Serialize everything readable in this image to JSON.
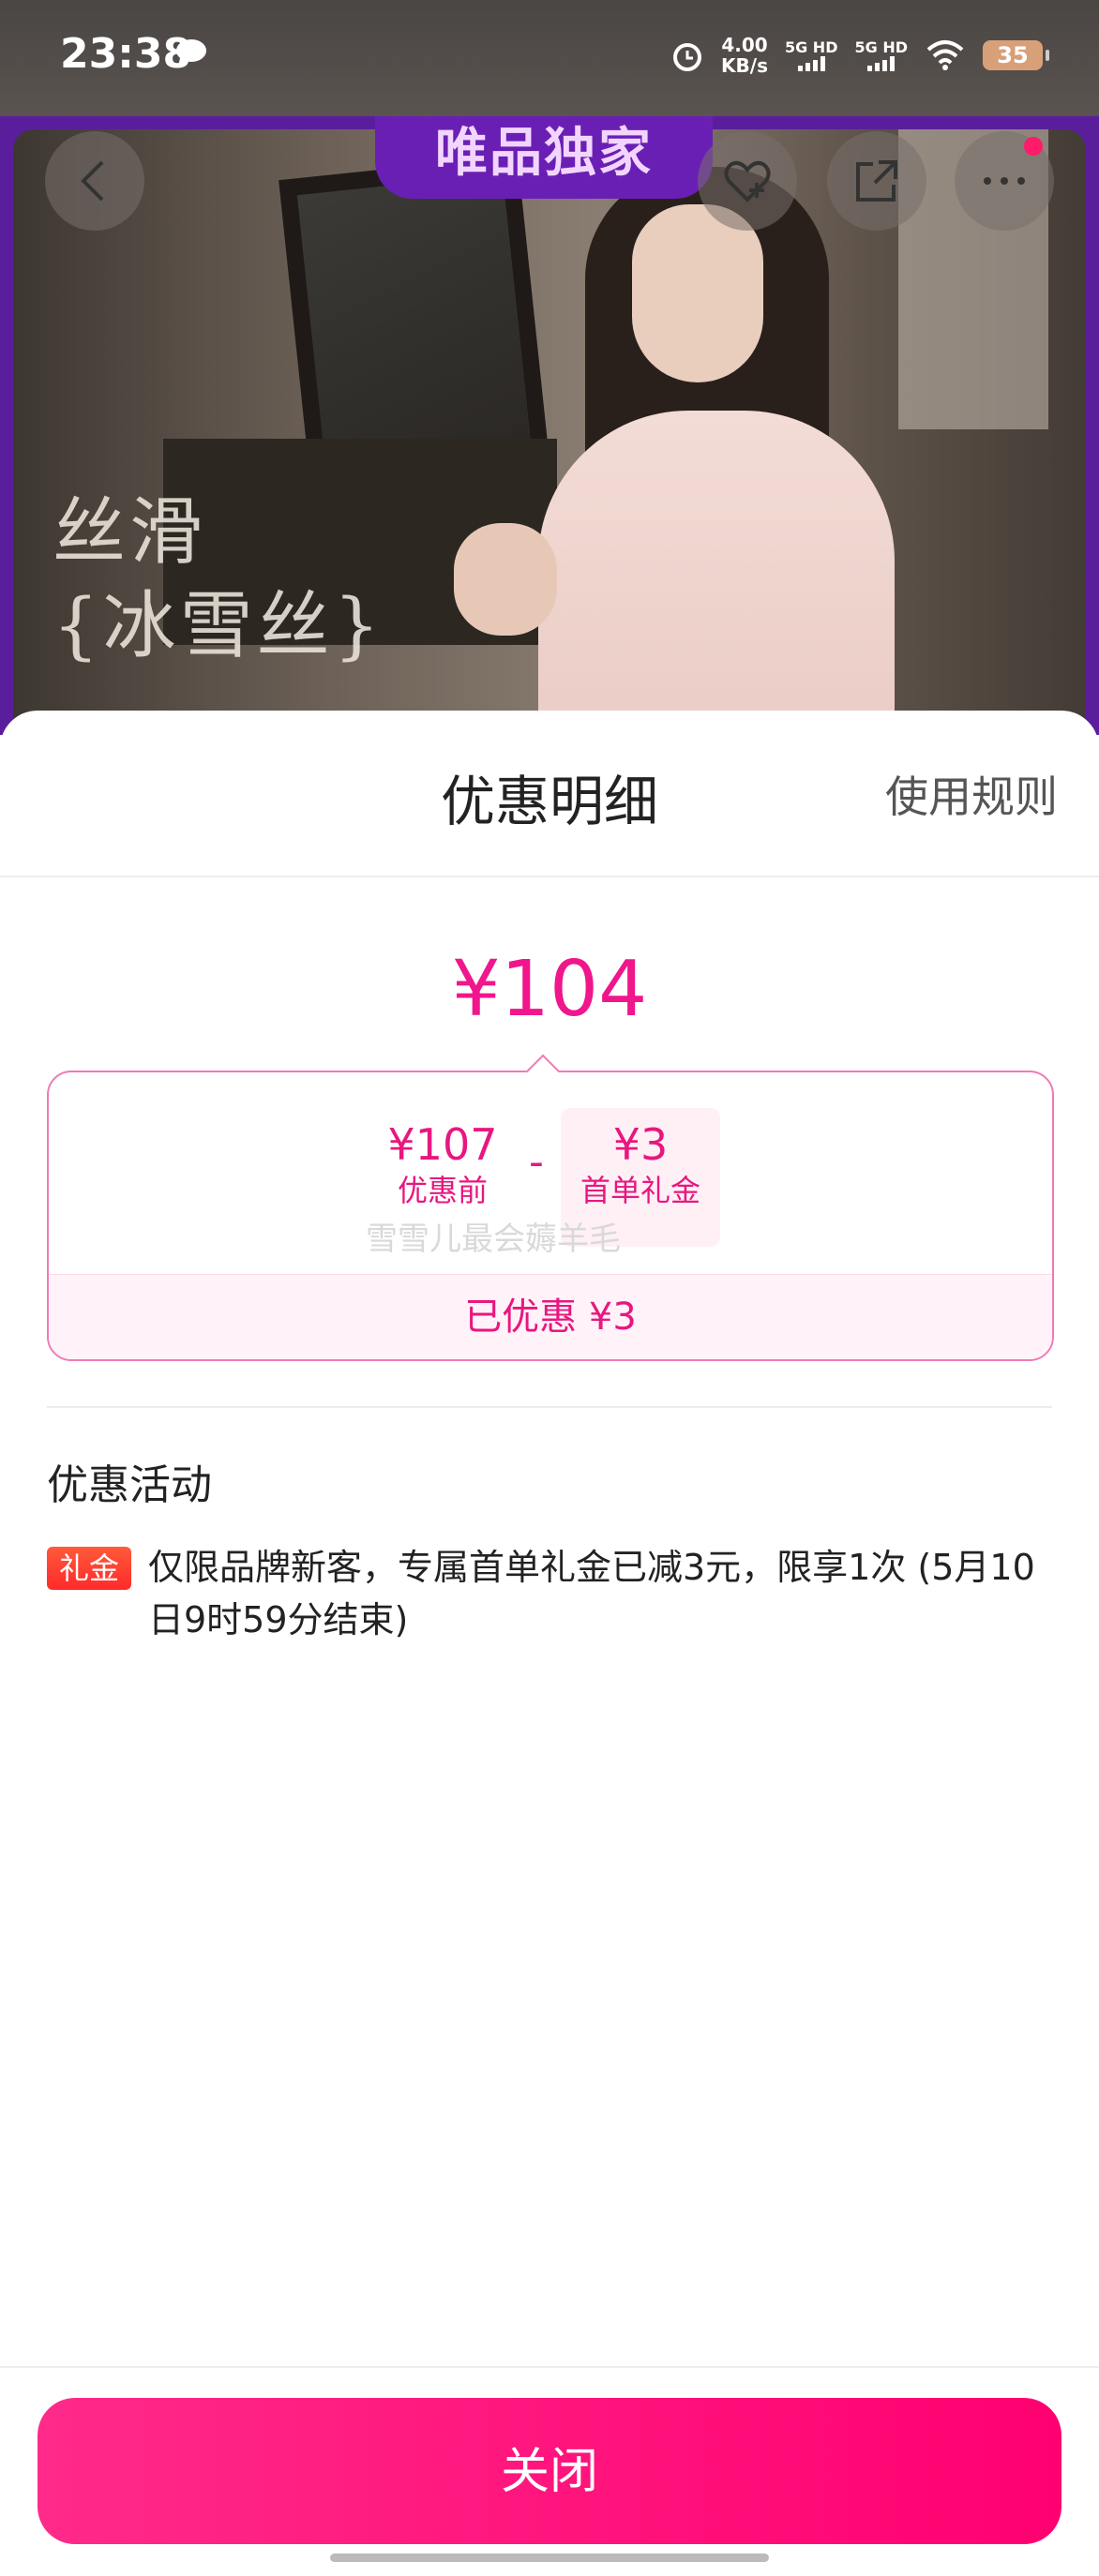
{
  "status_bar": {
    "time": "23:38",
    "speed_value": "4.00",
    "speed_unit": "KB/s",
    "sim1": "5G HD",
    "sim2": "5G HD",
    "battery": "35"
  },
  "hero": {
    "badge": "唯品独家",
    "headline_1": "丝滑",
    "headline_2": "{冰雪丝}"
  },
  "sheet": {
    "title": "优惠明细",
    "rules_link": "使用规则",
    "final_price": "¥104",
    "original_price": "¥107",
    "original_label": "优惠前",
    "operator": "-",
    "discount_value": "¥3",
    "discount_label": "首单礼金",
    "watermark": "雪雪儿最会薅羊毛",
    "saved_text": "已优惠 ¥3",
    "activities_title": "优惠活动",
    "activity_tag": "礼金",
    "activity_text": "仅限品牌新客，专属首单礼金已减3元，限享1次 (5月10日9时59分结束)",
    "close_button": "关闭"
  },
  "colors": {
    "accent": "#f0168b",
    "hero_border": "#5a1e9c",
    "close_button": "#ff0a7a"
  },
  "icons": [
    "back-icon",
    "favorite-add-icon",
    "share-icon",
    "more-icon"
  ]
}
